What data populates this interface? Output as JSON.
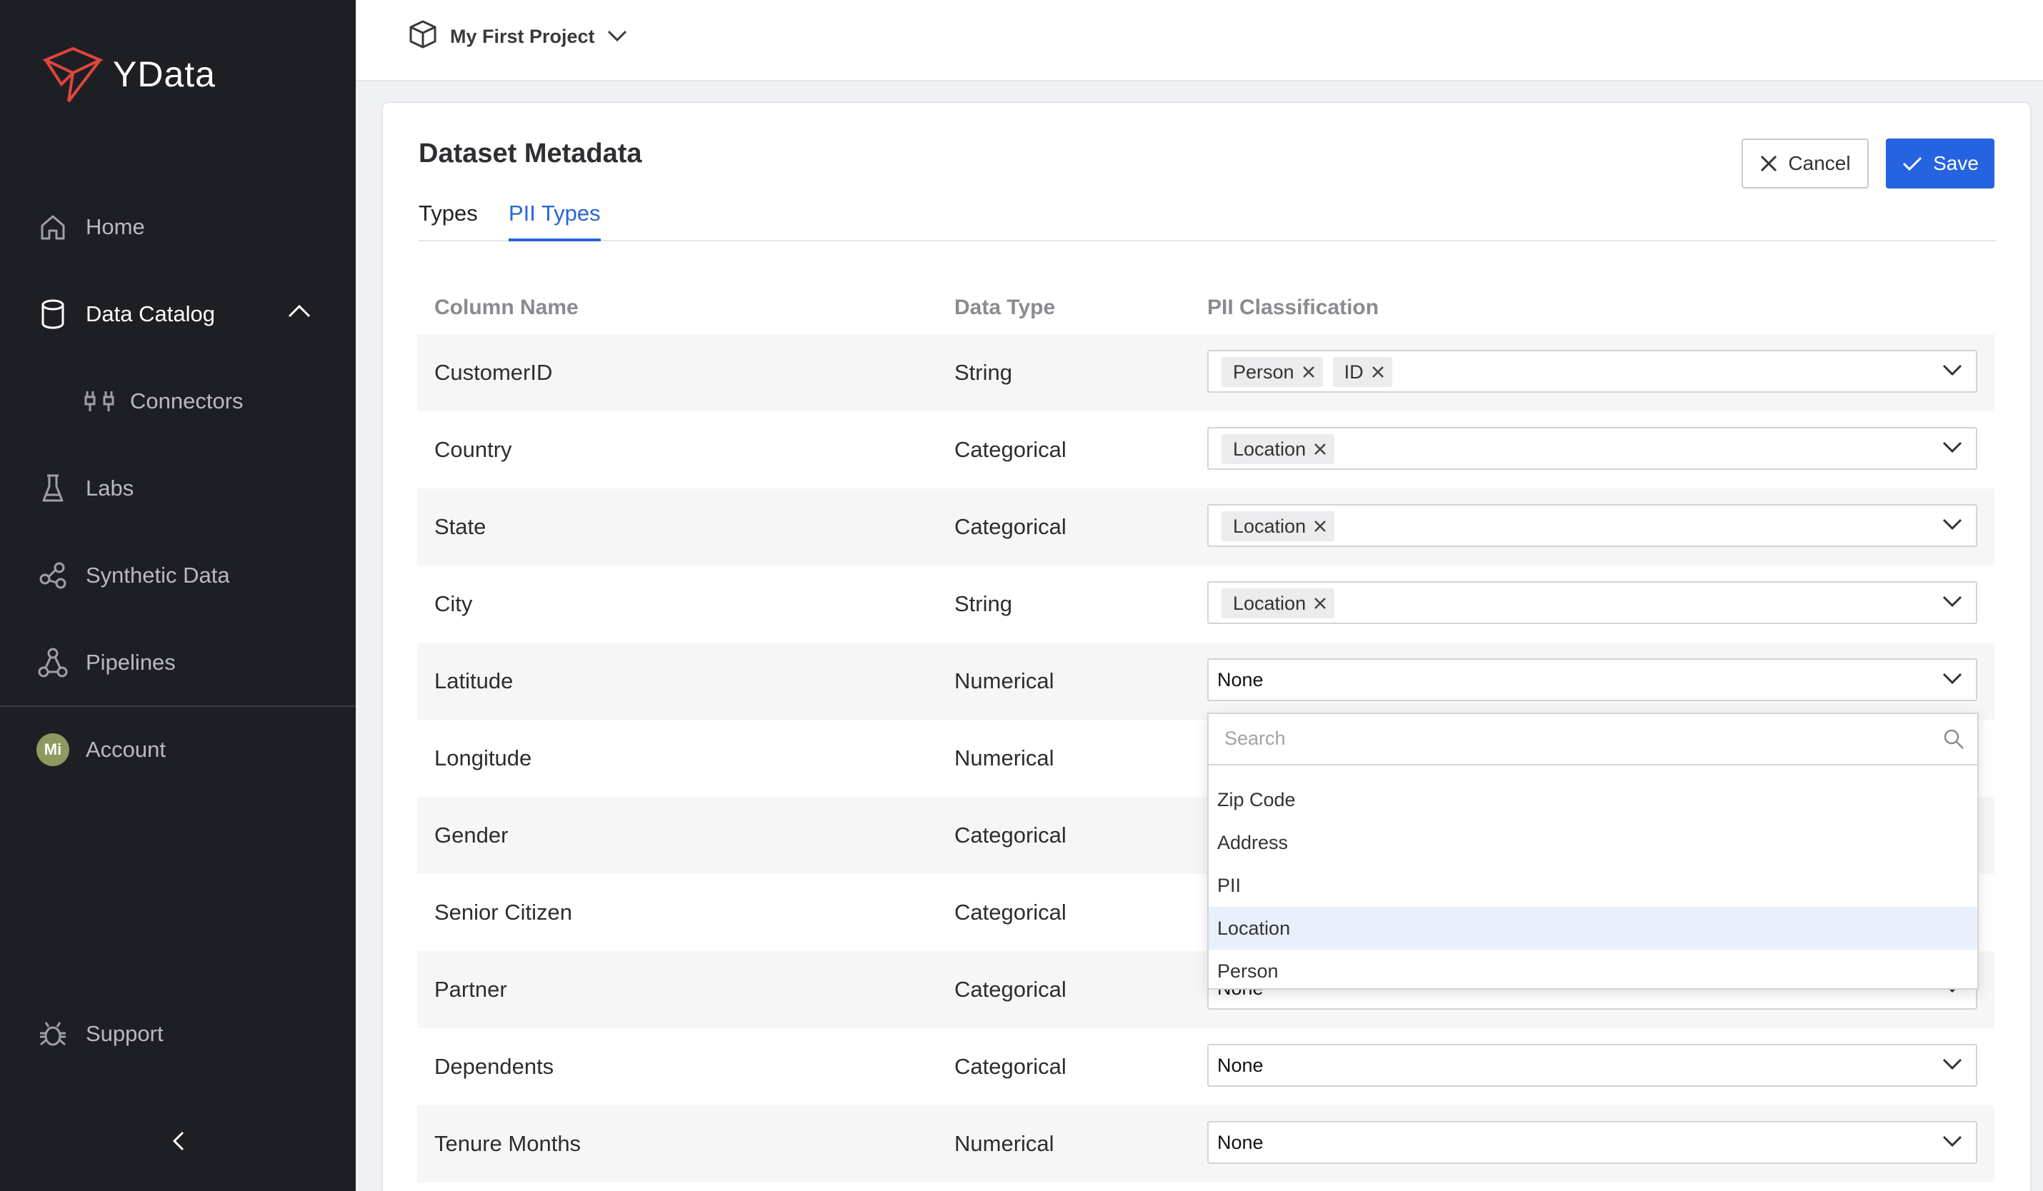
{
  "app": {
    "name": "YData",
    "brand_color": "#e0463b"
  },
  "sidebar": {
    "items": [
      {
        "label": "Home",
        "icon": "home-icon"
      },
      {
        "label": "Data Catalog",
        "icon": "database-icon"
      },
      {
        "label": "Connectors",
        "icon": "connectors-icon"
      },
      {
        "label": "Labs",
        "icon": "flask-icon"
      },
      {
        "label": "Synthetic Data",
        "icon": "synthetic-icon"
      },
      {
        "label": "Pipelines",
        "icon": "pipelines-icon"
      },
      {
        "label": "Account",
        "icon": "avatar"
      },
      {
        "label": "Support",
        "icon": "bug-icon"
      }
    ],
    "avatar_initials": "Mi"
  },
  "topbar": {
    "project_name": "My First Project"
  },
  "page": {
    "title": "Dataset Metadata",
    "cancel_label": "Cancel",
    "save_label": "Save",
    "tabs": [
      "Types",
      "PII Types"
    ],
    "active_tab": "PII Types"
  },
  "table": {
    "headers": [
      "Column Name",
      "Data Type",
      "PII Classification"
    ],
    "rows": [
      {
        "name": "CustomerID",
        "type": "String",
        "pii": [
          "Person",
          "ID"
        ]
      },
      {
        "name": "Country",
        "type": "Categorical",
        "pii": [
          "Location"
        ]
      },
      {
        "name": "State",
        "type": "Categorical",
        "pii": [
          "Location"
        ]
      },
      {
        "name": "City",
        "type": "String",
        "pii": [
          "Location"
        ]
      },
      {
        "name": "Latitude",
        "type": "Numerical",
        "value": "None"
      },
      {
        "name": "Longitude",
        "type": "Numerical",
        "value": ""
      },
      {
        "name": "Gender",
        "type": "Categorical",
        "value": ""
      },
      {
        "name": "Senior Citizen",
        "type": "Categorical",
        "value": ""
      },
      {
        "name": "Partner",
        "type": "Categorical",
        "value": "None"
      },
      {
        "name": "Dependents",
        "type": "Categorical",
        "value": "None"
      },
      {
        "name": "Tenure Months",
        "type": "Numerical",
        "value": "None"
      }
    ]
  },
  "dropdown": {
    "search_placeholder": "Search",
    "options": [
      "Zip Code",
      "Address",
      "PII",
      "Location",
      "Person"
    ],
    "highlighted": "Location"
  }
}
